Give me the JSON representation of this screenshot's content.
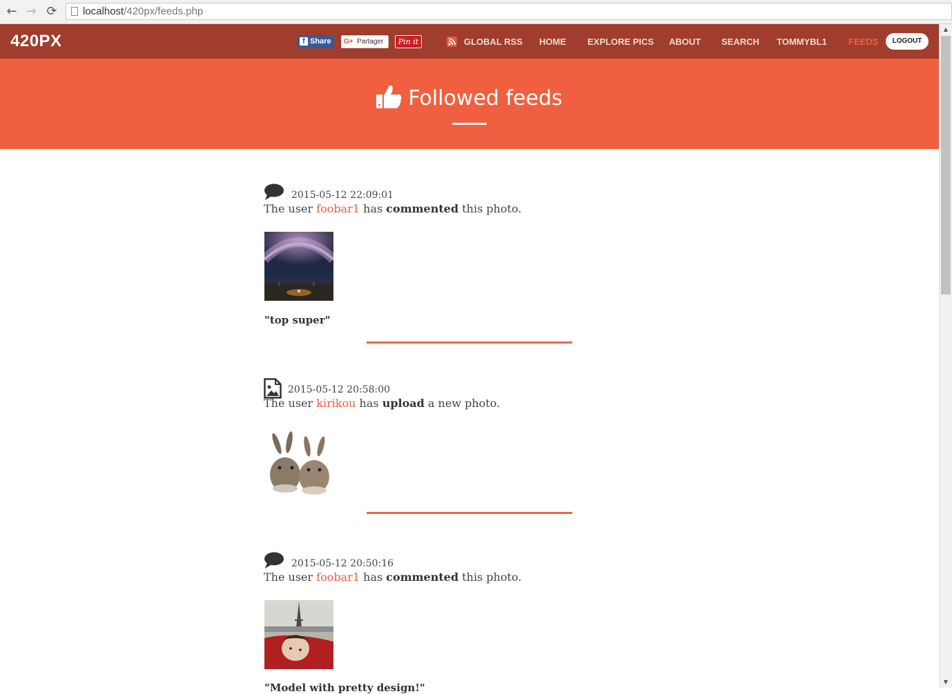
{
  "browser": {
    "url_host": "localhost",
    "url_path": "/420px/feeds.php",
    "back_icon": "←",
    "forward_icon": "→",
    "reload_icon": "⟳"
  },
  "header": {
    "logo": "420PX",
    "share_buttons": {
      "facebook": "Share",
      "google": "Partager",
      "pinterest": "Pin it"
    },
    "nav": [
      {
        "label": "GLOBAL RSS",
        "active": false
      },
      {
        "label": "HOME",
        "active": false
      },
      {
        "label": "EXPLORE PICS",
        "active": false
      },
      {
        "label": "ABOUT",
        "active": false
      },
      {
        "label": "SEARCH",
        "active": false
      },
      {
        "label": "TOMMYBL1",
        "active": false
      },
      {
        "label": "FEEDS",
        "active": true
      }
    ],
    "logout": "LOGOUT"
  },
  "banner": {
    "title": "Followed feeds",
    "icon": "thumbs-up-icon"
  },
  "feed": [
    {
      "type": "comment",
      "icon": "comment-icon",
      "date": "2015-05-12 22:09:01",
      "prefix": "The user ",
      "user": "foobar1",
      "mid": " has ",
      "action": "commented",
      "suffix": " this photo.",
      "photo": "milky-way-night-sky",
      "quote": "\"top super\""
    },
    {
      "type": "upload",
      "icon": "image-file-icon",
      "date": "2015-05-12 20:58:00",
      "prefix": "The user ",
      "user": "kirikou",
      "mid": " has ",
      "action": "upload",
      "suffix": " a new photo.",
      "photo": "two-rabbits"
    },
    {
      "type": "comment",
      "icon": "comment-icon",
      "date": "2015-05-12 20:50:16",
      "prefix": "The user ",
      "user": "foobar1",
      "mid": " has ",
      "action": "commented",
      "suffix": " this photo.",
      "photo": "eiffel-tower-selfie",
      "quote": "\"Model with pretty design!\""
    }
  ],
  "colors": {
    "header": "#a03d2c",
    "banner": "#f06040",
    "accent": "#e0603f",
    "divider": "#e8654a"
  }
}
